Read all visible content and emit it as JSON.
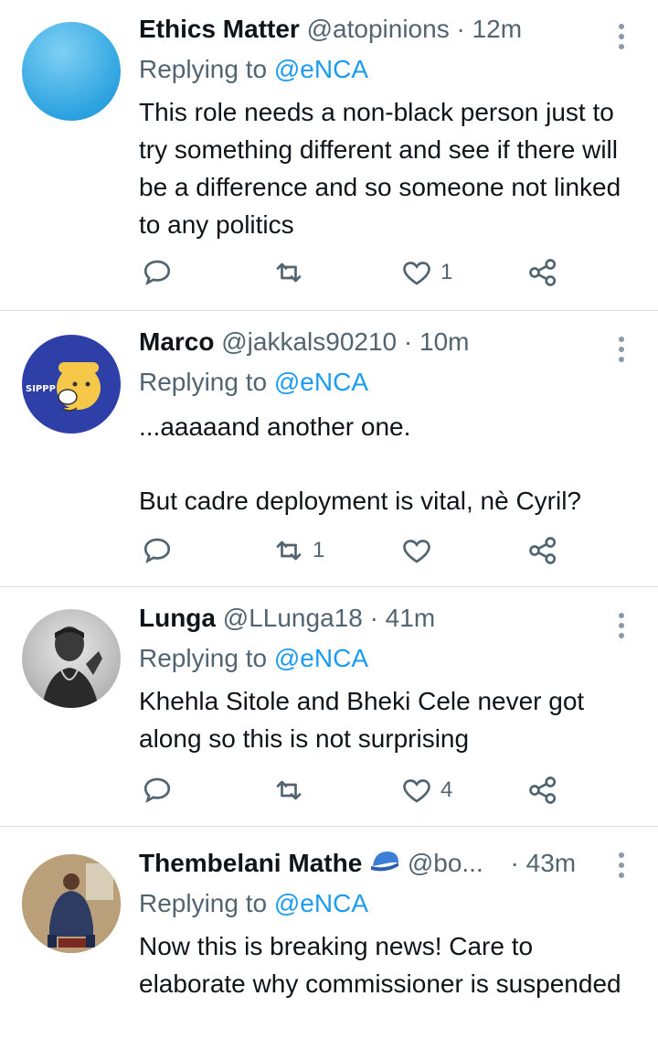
{
  "tweets": [
    {
      "name": "Ethics Matter",
      "handle": "@atopinions",
      "time": "· 12m",
      "replying_prefix": "Replying to ",
      "replying_to": "@eNCA",
      "text": [
        "This role needs a non-black person just to try something different and see if there will be a difference and so someone not linked to any politics"
      ],
      "reply_count": "",
      "retweet_count": "",
      "like_count": "1",
      "avatar": "blue-gradient-avatar"
    },
    {
      "name": "Marco",
      "handle": "@jakkals90210",
      "time": "· 10m",
      "replying_prefix": "Replying to ",
      "replying_to": "@eNCA",
      "text": [
        "...aaaaand another one.",
        "But cadre deployment is vital, nè Cyril?"
      ],
      "reply_count": "",
      "retweet_count": "1",
      "like_count": "",
      "avatar": "cartoon-sipping-avatar",
      "avatar_text": "SIPPP"
    },
    {
      "name": "Lunga",
      "handle": "@LLunga18",
      "time": "· 41m",
      "replying_prefix": "Replying to ",
      "replying_to": "@eNCA",
      "text": [
        "Khehla Sitole and Bheki Cele never got along so this is not surprising"
      ],
      "reply_count": "",
      "retweet_count": "",
      "like_count": "4",
      "avatar": "grayscale-portrait-avatar"
    },
    {
      "name": "Thembelani Mathe",
      "handle": "@bo...",
      "time": "· 43m",
      "replying_prefix": "Replying to ",
      "replying_to": "@eNCA",
      "text": [
        "Now this is breaking news! Care to elaborate why commissioner is suspended"
      ],
      "avatar": "seated-person-photo-avatar",
      "badge_icon": "blue-cap-emoji-icon"
    }
  ],
  "icons": {
    "reply": "reply-icon",
    "retweet": "retweet-icon",
    "like": "heart-icon",
    "share": "share-icon",
    "more": "more-vertical-icon"
  },
  "colors": {
    "text": "#0f1419",
    "muted": "#536471",
    "link": "#1d9bf0",
    "divider": "#d9dde1"
  }
}
